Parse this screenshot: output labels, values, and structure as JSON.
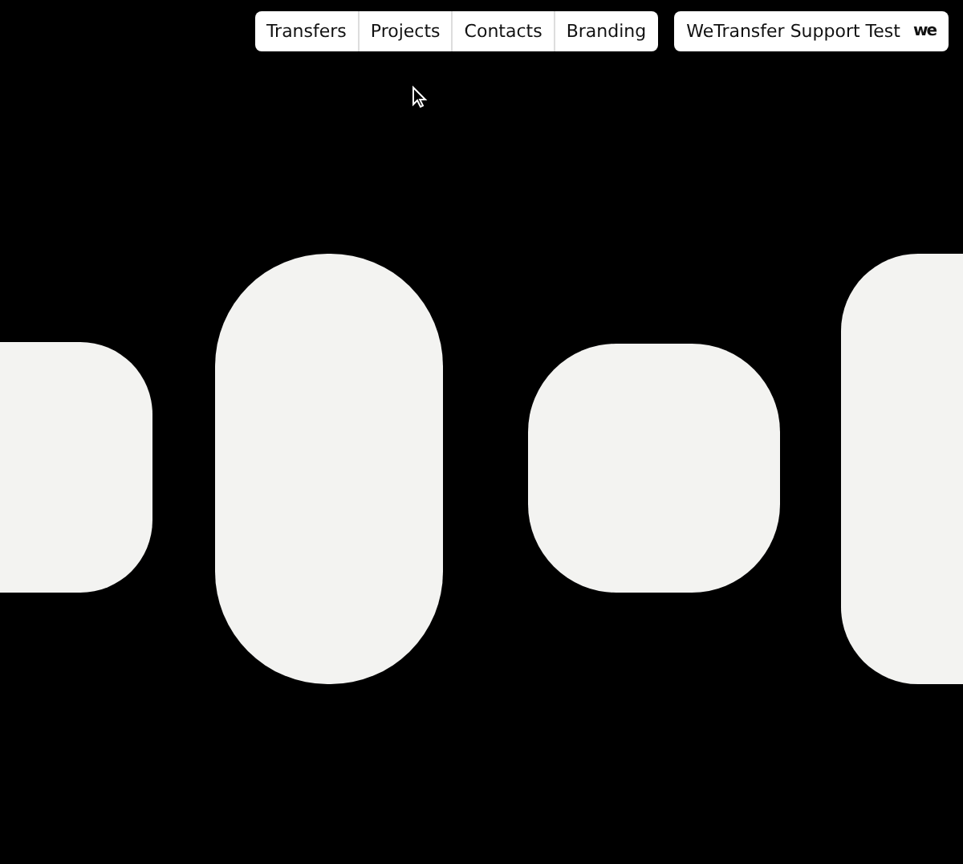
{
  "nav": {
    "items": [
      {
        "label": "Transfers"
      },
      {
        "label": "Projects"
      },
      {
        "label": "Contacts"
      },
      {
        "label": "Branding"
      }
    ]
  },
  "account": {
    "name": "WeTransfer Support Test",
    "logo": "we"
  }
}
